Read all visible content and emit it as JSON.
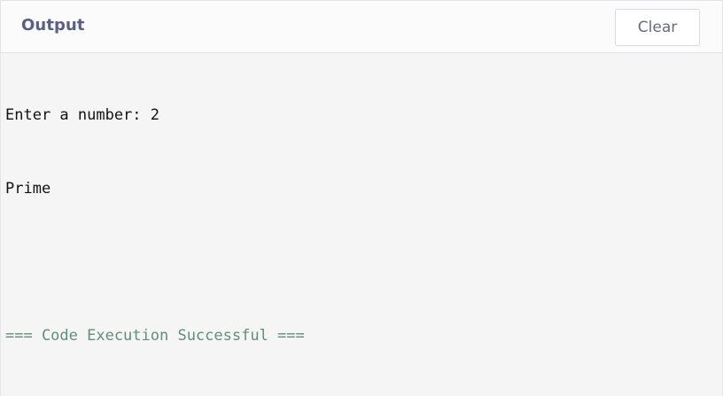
{
  "panel": {
    "title": "Output",
    "clear_label": "Clear"
  },
  "console": {
    "lines": [
      "Enter a number: 2",
      "Prime",
      "",
      "=== Code Execution Successful ==="
    ]
  },
  "colors": {
    "header_text": "#5b5f86",
    "success_text": "#5f8f7a",
    "console_background": "#f5f5f5",
    "button_border": "#d8d9e1"
  }
}
